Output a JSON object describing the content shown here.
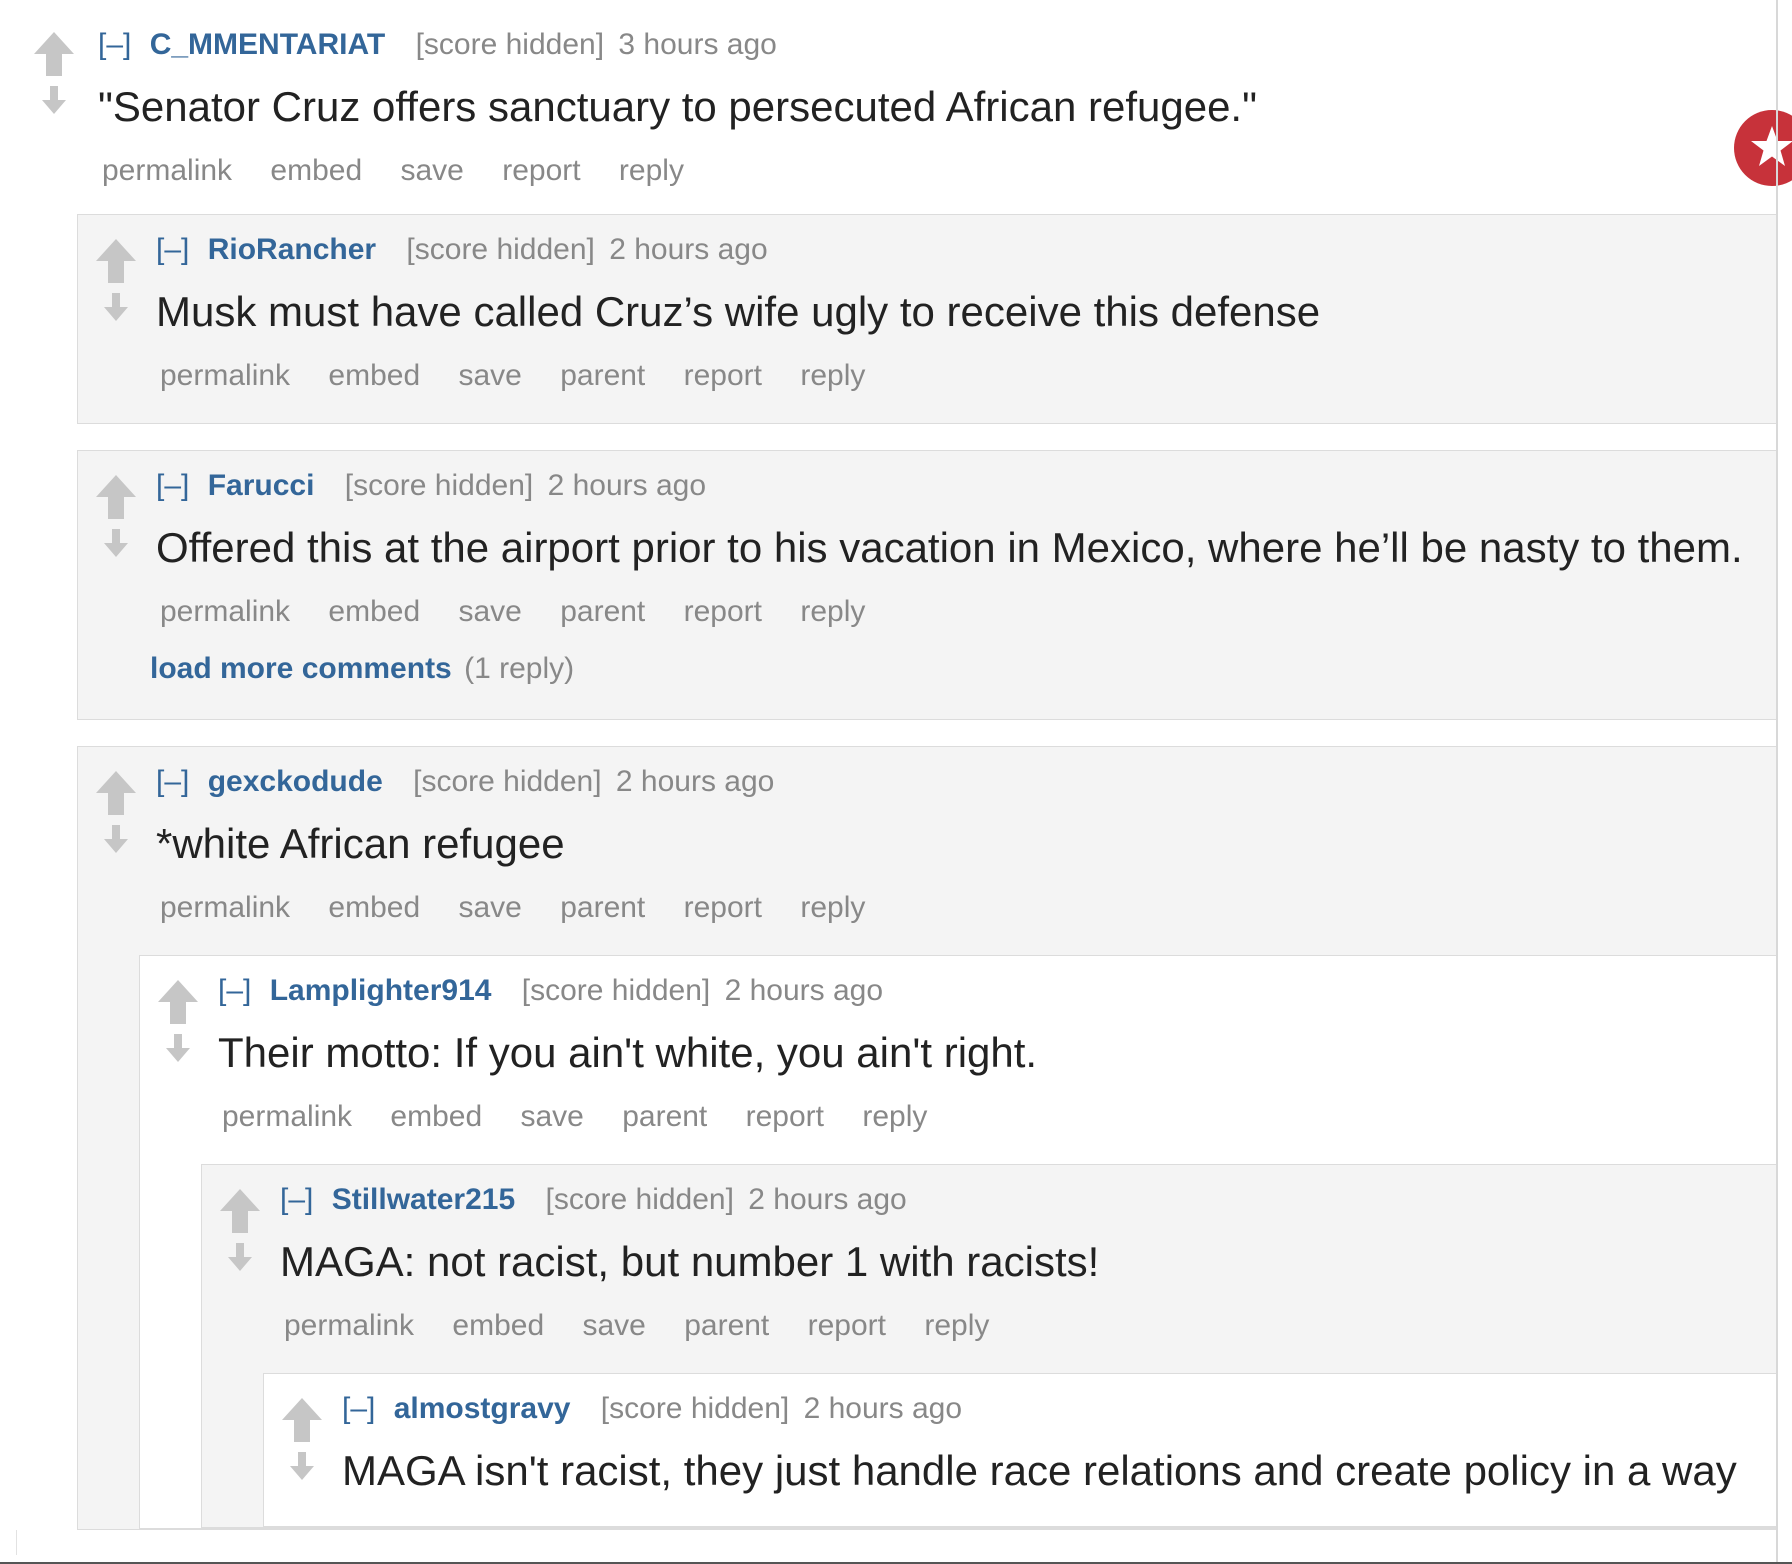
{
  "comments": [
    {
      "expand": "[–]",
      "author": "C_MMENTARIAT",
      "score": "[score hidden]",
      "time": "3 hours ago",
      "body": "\"Senator Cruz offers sanctuary to persecuted African refugee.\"",
      "buttons": [
        "permalink",
        "embed",
        "save",
        "report",
        "reply"
      ]
    },
    {
      "expand": "[–]",
      "author": "RioRancher",
      "score": "[score hidden]",
      "time": "2 hours ago",
      "body": "Musk must have called Cruz’s wife ugly to receive this defense",
      "buttons": [
        "permalink",
        "embed",
        "save",
        "parent",
        "report",
        "reply"
      ]
    },
    {
      "expand": "[–]",
      "author": "Farucci",
      "score": "[score hidden]",
      "time": "2 hours ago",
      "body": "Offered this at the airport prior to his vacation in Mexico, where he’ll be nasty to them.",
      "buttons": [
        "permalink",
        "embed",
        "save",
        "parent",
        "report",
        "reply"
      ],
      "more_link": "load more comments",
      "more_count": "(1 reply)"
    },
    {
      "expand": "[–]",
      "author": "gexckodude",
      "score": "[score hidden]",
      "time": "2 hours ago",
      "body": "*white African refugee",
      "buttons": [
        "permalink",
        "embed",
        "save",
        "parent",
        "report",
        "reply"
      ]
    },
    {
      "expand": "[–]",
      "author": "Lamplighter914",
      "score": "[score hidden]",
      "time": "2 hours ago",
      "body": "Their motto: If you ain't white, you ain't right.",
      "buttons": [
        "permalink",
        "embed",
        "save",
        "parent",
        "report",
        "reply"
      ]
    },
    {
      "expand": "[–]",
      "author": "Stillwater215",
      "score": "[score hidden]",
      "time": "2 hours ago",
      "body": "MAGA: not racist, but number 1 with racists!",
      "buttons": [
        "permalink",
        "embed",
        "save",
        "parent",
        "report",
        "reply"
      ]
    },
    {
      "expand": "[–]",
      "author": "almostgravy",
      "score": "[score hidden]",
      "time": "2 hours ago",
      "body": "MAGA isn't racist, they just handle race relations and create policy in a way"
    }
  ],
  "colors": {
    "link_blue": "#336699",
    "meta_gray": "#888888",
    "nested_bg": "#f4f4f4",
    "badge_red": "#c7323a"
  },
  "icons": [
    "upvote-arrow-icon",
    "downvote-arrow-icon",
    "star-icon"
  ]
}
